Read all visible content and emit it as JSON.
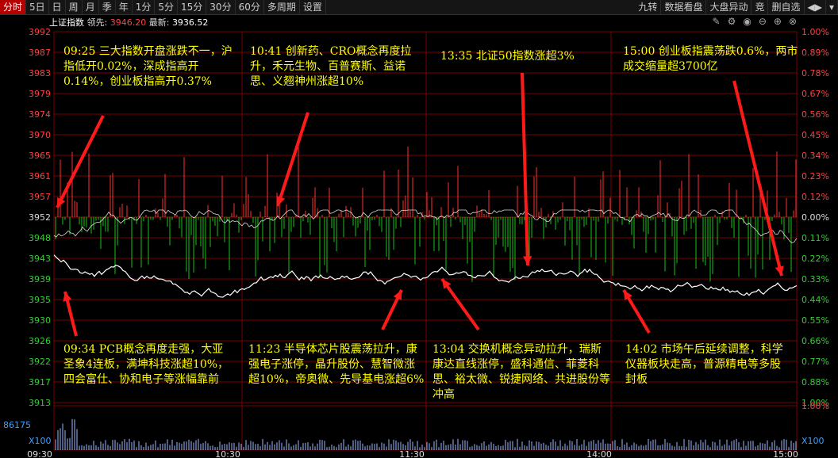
{
  "toolbar": {
    "left": [
      "分时",
      "5日",
      "日",
      "周",
      "月",
      "季",
      "年",
      "1分",
      "5分",
      "15分",
      "30分",
      "60分",
      "多周期",
      "设置"
    ],
    "right": [
      "九转",
      "数据看盘",
      "大盘异动",
      "竞",
      "删自选",
      "◀▶",
      "▾"
    ]
  },
  "info": {
    "name": "上证指数",
    "lead_label": "领先:",
    "lead_value": "3946.20",
    "latest_label": "最新:",
    "latest_value": "3936.52"
  },
  "axes": {
    "left_prices": [
      "3992",
      "3987",
      "3983",
      "3979",
      "3974",
      "3970",
      "3965",
      "3961",
      "3957",
      "3952",
      "3948",
      "3943",
      "3939",
      "3935",
      "3930",
      "3926",
      "3922",
      "3917",
      "3913"
    ],
    "right_pcts": [
      "1.00%",
      "0.89%",
      "0.78%",
      "0.67%",
      "0.56%",
      "0.45%",
      "0.34%",
      "0.23%",
      "0.12%",
      "0.00%",
      "0.11%",
      "0.22%",
      "0.33%",
      "0.44%",
      "0.55%",
      "0.66%",
      "0.77%",
      "0.88%",
      "1.00%"
    ],
    "vol_left_top": "86175",
    "vol_left_bottom": "X100",
    "vol_right_top": "1.00%",
    "vol_right_bottom": "X100",
    "time_labels": [
      "09:30",
      "10:30",
      "11:30",
      "14:00",
      "15:00"
    ]
  },
  "annotations": [
    "09:25 三大指数开盘涨跌不一，沪指低开0.02%，深成指高开0.14%，创业板指高开0.37%",
    "10:41 创新药、CRO概念再度拉升，禾元生物、百普赛斯、益诺思、义翘神州涨超10%",
    "13:35 北证50指数涨超3%",
    "15:00 创业板指震荡跌0.6%，两市成交缩量超3700亿",
    "09:34 PCB概念再度走强，大亚圣象4连板，满坤科技涨超10%，四会富仕、协和电子等涨幅靠前",
    "11:23 半导体芯片股震荡拉升，康强电子涨停，晶升股份、慧智微涨超10%，帝奥微、先导基电涨超6%",
    "13:04 交换机概念异动拉升，瑞斯康达直线涨停，盛科通信、菲菱科思、裕太微、锐捷网络、共进股份等冲高",
    "14:02 市场午后延续调整，科学仪器板块走高，普源精电等多股封板"
  ],
  "colors": {
    "up": "#ff3030",
    "down": "#19c419",
    "grid": "#7a0000",
    "price_line": "#ffffff",
    "annotation": "#ffff00"
  }
}
